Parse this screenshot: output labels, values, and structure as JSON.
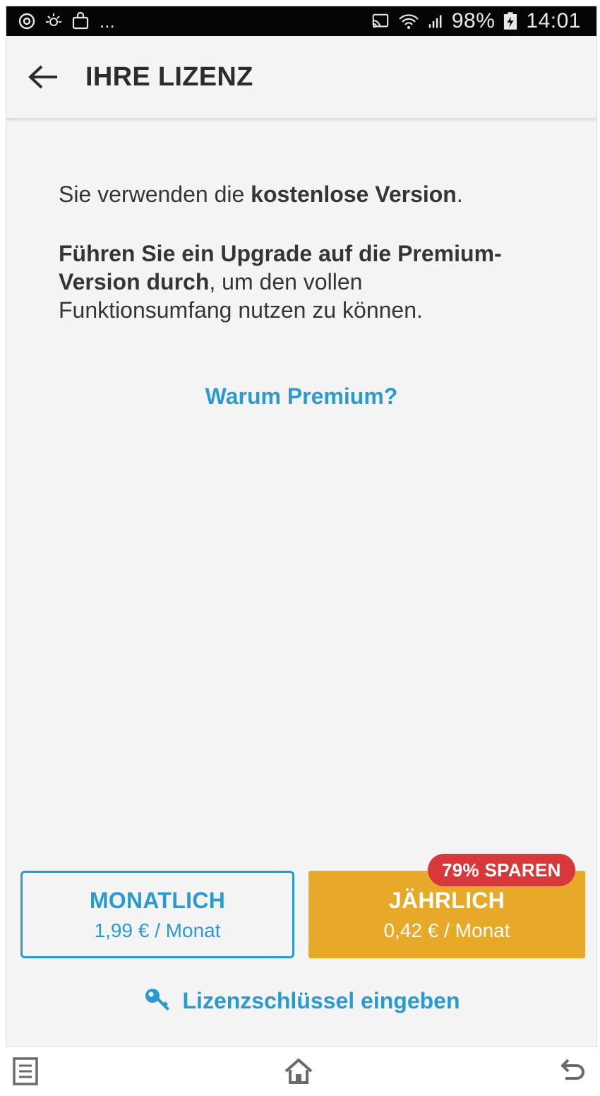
{
  "statusbar": {
    "battery": "98%",
    "time": "14:01",
    "dots": "..."
  },
  "appbar": {
    "title": "IHRE LIZENZ"
  },
  "content": {
    "line1_prefix": "Sie verwenden die ",
    "line1_bold": "kostenlose Version",
    "line1_suffix": ".",
    "para2_bold": "Führen Sie ein Upgrade auf die Premium-Version durch",
    "para2_rest": ", um den vollen Funktionsumfang nutzen zu können.",
    "why_link": "Warum Premium?"
  },
  "plans": {
    "monthly": {
      "name": "MONATLICH",
      "price": "1,99 € / Monat"
    },
    "yearly": {
      "name": "JÄHRLICH",
      "price": "0,42  € / Monat",
      "badge": "79% SPAREN"
    }
  },
  "license_link": "Lizenzschlüssel eingeben",
  "colors": {
    "accent": "#2a9bd0",
    "yearly": "#e8a828",
    "badge": "#d8383a"
  },
  "icons": {
    "back": "arrow-left-icon",
    "key": "key-icon",
    "nav_recent": "recent-apps-icon",
    "nav_home": "home-icon",
    "nav_back": "back-icon"
  }
}
